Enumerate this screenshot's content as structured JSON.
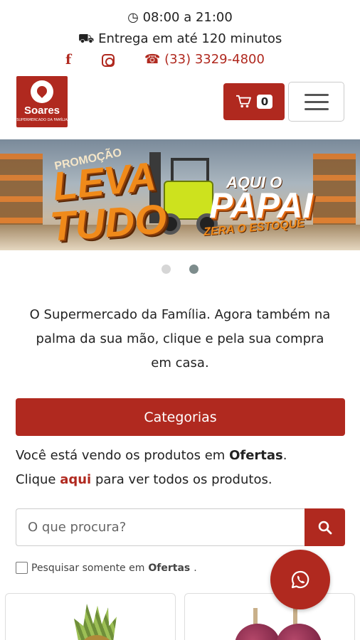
{
  "header": {
    "hours_icon": "clock-icon",
    "hours": "08:00 a 21:00",
    "delivery_icon": "truck-icon",
    "delivery": "Entrega em até 120 minutos",
    "facebook_icon": "facebook-icon",
    "instagram_icon": "instagram-icon",
    "phone_icon": "phone-icon",
    "phone": "(33) 3329-4800"
  },
  "logo": {
    "name": "Soares",
    "tagline": "SUPERMERCADO DA FAMÍLIA"
  },
  "cart": {
    "icon": "cart-icon",
    "count": "0"
  },
  "menu": {
    "icon": "hamburger-menu-icon"
  },
  "banner": {
    "promo": "PROMOÇÃO",
    "line1": "LEVA",
    "line2": "TUDO",
    "aqui": "AQUI O",
    "papai": "PAPAI",
    "zera": "ZERA O ESTOQUE"
  },
  "carousel": {
    "slides": 2,
    "active": 2
  },
  "intro": "O Supermercado da Família. Agora também na palma da sua mão, clique e pela sua compra em casa.",
  "categories_button": "Categorias",
  "viewing": {
    "prefix": "Você está vendo os produtos em ",
    "section": "Ofertas",
    "suffix": ".",
    "click": "Clique ",
    "link": "aqui",
    "rest": " para ver todos os produtos."
  },
  "search": {
    "placeholder": "O que procura?",
    "value": "",
    "button_icon": "search-icon"
  },
  "only_filter": {
    "label_prefix": "Pesquisar somente em ",
    "section": "Ofertas",
    "suffix": ".",
    "checked": false
  },
  "whatsapp": {
    "icon": "whatsapp-icon"
  },
  "colors": {
    "brand": "#b0291f",
    "text": "#222222",
    "dot_inactive": "#d6d6d6",
    "dot_active": "#7d8c8c"
  }
}
